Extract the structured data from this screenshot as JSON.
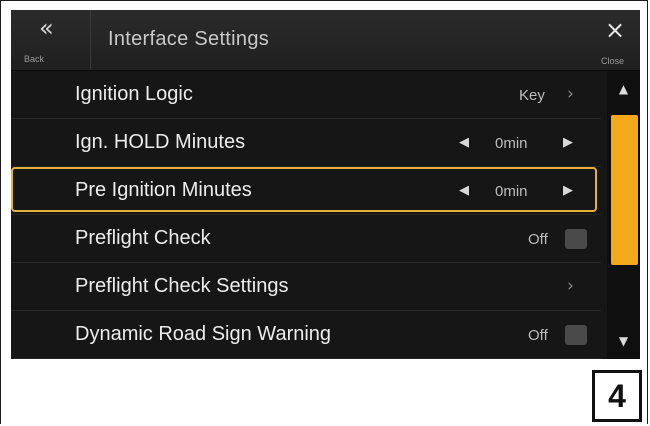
{
  "header": {
    "back_icon": "«",
    "back_label": "Back",
    "title": "Interface Settings",
    "close_icon": "×",
    "close_label": "Close"
  },
  "rows": [
    {
      "label": "Ignition Logic",
      "value": "Key",
      "control": "chevron-right"
    },
    {
      "label": "Ign. HOLD Minutes",
      "value": "0min",
      "control": "stepper"
    },
    {
      "label": "Pre Ignition Minutes",
      "value": "0min",
      "control": "stepper",
      "selected": true
    },
    {
      "label": "Preflight Check",
      "value": "Off",
      "control": "checkbox"
    },
    {
      "label": "Preflight Check Settings",
      "value": "",
      "control": "chevron-right"
    },
    {
      "label": "Dynamic Road Sign Warning",
      "value": "Off",
      "control": "checkbox"
    }
  ],
  "glyphs": {
    "chevron_right": "›",
    "arrow_left": "◀",
    "arrow_right": "▶",
    "scroll_up": "▲",
    "scroll_down": "▼"
  },
  "colors": {
    "highlight": "#e3b236",
    "scroll_thumb": "#f3a91a",
    "background": "#161616"
  },
  "page_marker": "4"
}
